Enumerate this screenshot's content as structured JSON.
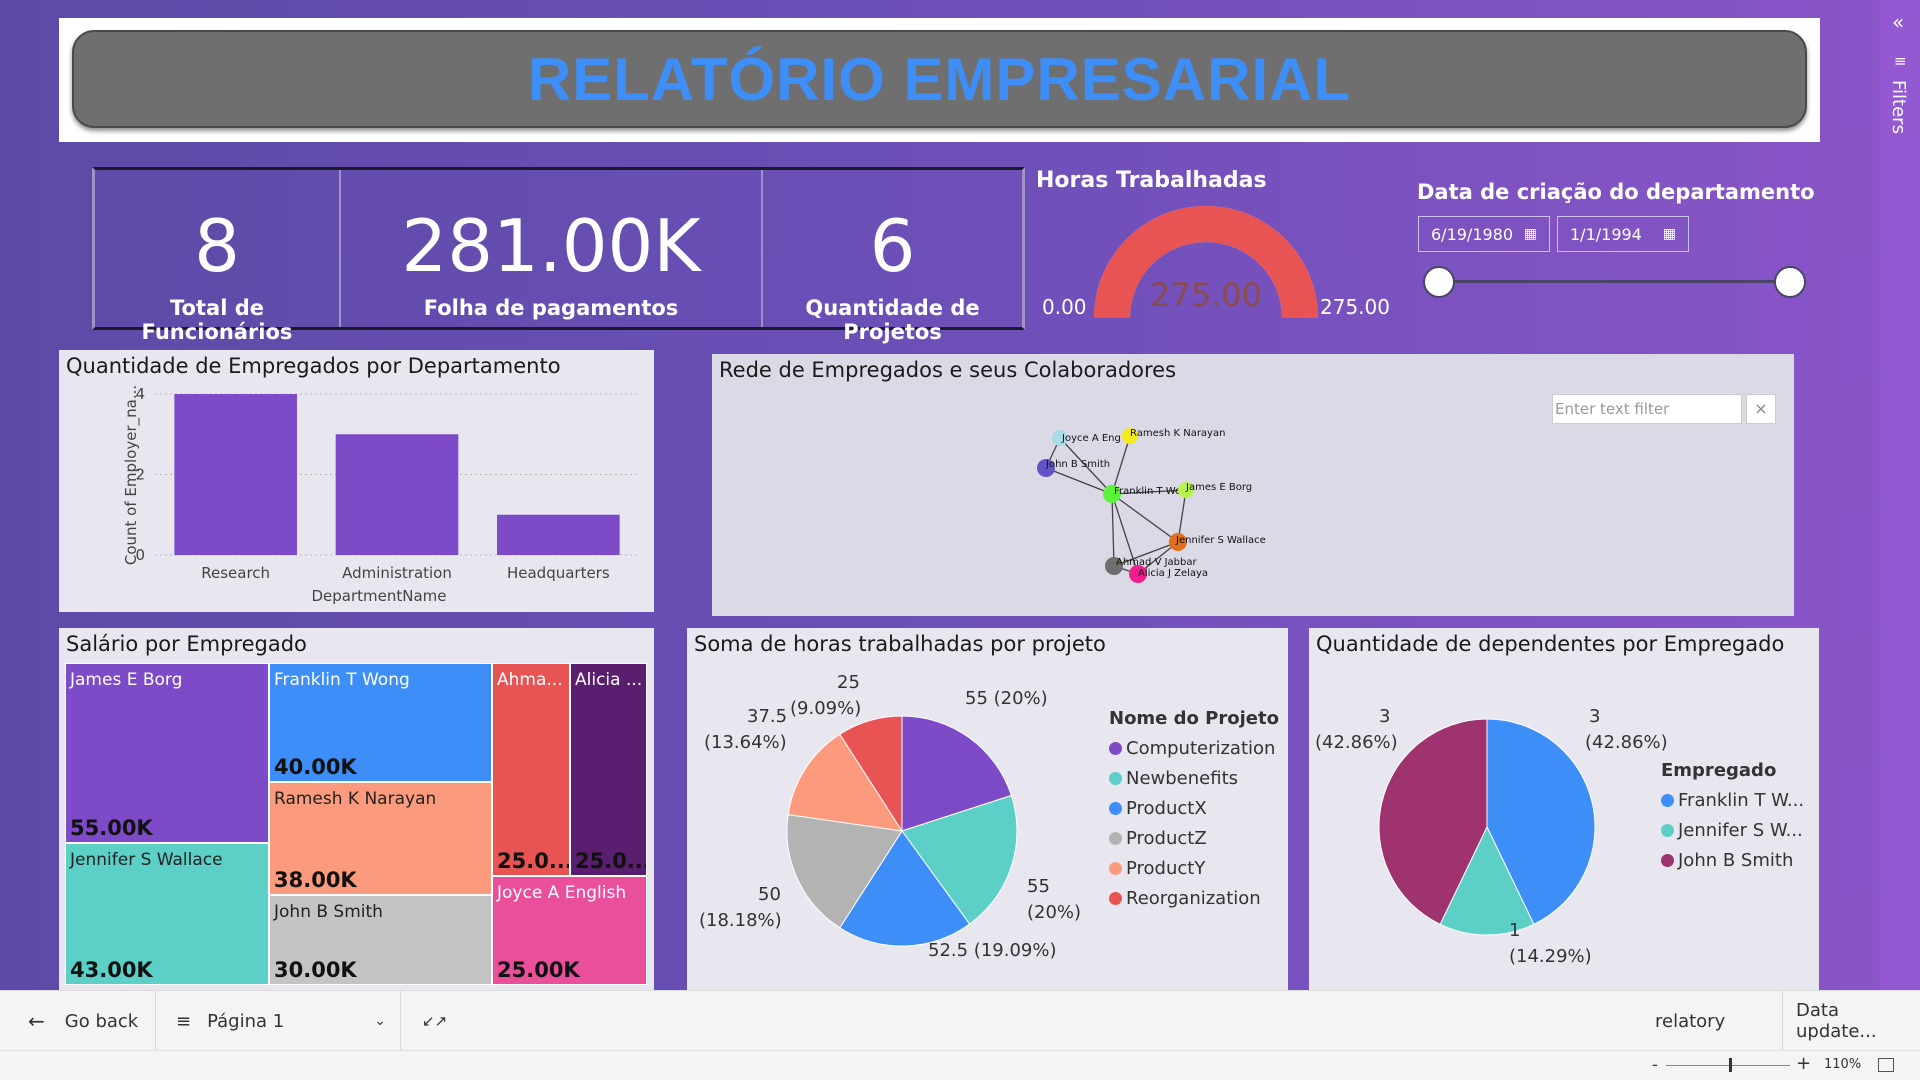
{
  "header": {
    "title": "RELATÓRIO EMPRESARIAL"
  },
  "kpis": [
    {
      "value": "8",
      "label": "Total de Funcionários"
    },
    {
      "value": "281.00K",
      "label": "Folha de pagamentos"
    },
    {
      "value": "6",
      "label": "Quantidade de Projetos"
    }
  ],
  "gauge": {
    "title": "Horas Trabalhadas",
    "min": "0.00",
    "max": "275.00",
    "value": "275.00",
    "fill_fraction": 1.0,
    "color": "#e85454"
  },
  "slicer": {
    "title": "Data de criação do departamento",
    "start": "6/19/1980",
    "end": "1/1/1994",
    "calendar_icon": "calendar-icon"
  },
  "bar_chart": {
    "title": "Quantidade de Empregados por Departamento",
    "ylabel": "Count of Employer_na...",
    "xlabel": "DepartmentName",
    "yticks": [
      "0",
      "2",
      "4"
    ]
  },
  "network": {
    "title": "Rede de Empregados e seus Colaboradores",
    "filter_placeholder": "Enter text filter",
    "clear_label": "×",
    "nodes": [
      {
        "label": "Joyce A Eng",
        "color": "#a7dbe8"
      },
      {
        "label": "Ramesh K Narayan",
        "color": "#f5ea1c"
      },
      {
        "label": "John B Smith",
        "color": "#6353c9"
      },
      {
        "label": "Franklin T Wo",
        "color": "#5cf23a"
      },
      {
        "label": "James E Borg",
        "color": "#b8f24a"
      },
      {
        "label": "Jennifer S Wallace",
        "color": "#e0701c"
      },
      {
        "label": "Ahmad V Jabbar",
        "color": "#6e6e6e"
      },
      {
        "label": "Alicia J Zelaya",
        "color": "#f01f8c"
      }
    ]
  },
  "treemap": {
    "title": "Salário por Empregado",
    "cells": [
      {
        "name": "James E Borg",
        "value": "55.00K",
        "color": "#7d4ac8"
      },
      {
        "name": "Franklin T Wong",
        "value": "40.00K",
        "color": "#3d8ef7"
      },
      {
        "name": "Ahma...",
        "value": "25.0...",
        "color": "#e85454"
      },
      {
        "name": "Alicia ...",
        "value": "25.0...",
        "color": "#5a1e6e"
      },
      {
        "name": "Ramesh K Narayan",
        "value": "38.00K",
        "color": "#fb9a7d"
      },
      {
        "name": "Jennifer S Wallace",
        "value": "43.00K",
        "color": "#5ccfc6"
      },
      {
        "name": "John B Smith",
        "value": "30.00K",
        "color": "#c4c4c4"
      },
      {
        "name": "Joyce A English",
        "value": "25.00K",
        "color": "#e94f9b"
      }
    ]
  },
  "project_pie": {
    "title": "Soma de horas trabalhadas por projeto",
    "legend_title": "Nome do Projeto",
    "labels": [
      {
        "line1": "55 (20%)",
        "line2": ""
      },
      {
        "line1": "55",
        "line2": "(20%)"
      },
      {
        "line1": "52.5 (19.09%)",
        "line2": ""
      },
      {
        "line1": "50",
        "line2": "(18.18%)"
      },
      {
        "line1": "37.5",
        "line2": "(13.64%)"
      },
      {
        "line1": "25",
        "line2": "(9.09%)"
      }
    ]
  },
  "dependents_pie": {
    "title": "Quantidade de dependentes por Empregado",
    "legend_title": "Empregado",
    "legend": [
      {
        "name": "Franklin T W...",
        "color": "#3d8ef7"
      },
      {
        "name": "Jennifer S W...",
        "color": "#5ccfc6"
      },
      {
        "name": "John B Smith",
        "color": "#9e3370"
      }
    ],
    "labels": [
      {
        "line1": "3",
        "line2": "(42.86%)"
      },
      {
        "line1": "1",
        "line2": "(14.29%)"
      },
      {
        "line1": "3",
        "line2": "(42.86%)"
      }
    ]
  },
  "chart_data": [
    {
      "type": "bar",
      "title": "Quantidade de Empregados por Departamento",
      "categories": [
        "Research",
        "Administration",
        "Headquarters"
      ],
      "values": [
        4,
        3,
        1
      ],
      "xlabel": "DepartmentName",
      "ylabel": "Count of Employer_na...",
      "ylim": [
        0,
        4
      ],
      "color": "#7d4ac8"
    },
    {
      "type": "pie",
      "title": "Soma de horas trabalhadas por projeto",
      "categories": [
        "Computerization",
        "Newbenefits",
        "ProductX",
        "ProductZ",
        "ProductY",
        "Reorganization"
      ],
      "values": [
        55,
        55,
        52.5,
        50,
        37.5,
        25
      ],
      "colors": [
        "#7d4ac8",
        "#5ccfc6",
        "#3d8ef7",
        "#b3b3b3",
        "#fb9a7d",
        "#e85454"
      ]
    },
    {
      "type": "pie",
      "title": "Quantidade de dependentes por Empregado",
      "categories": [
        "Franklin T W...",
        "Jennifer S W...",
        "John B Smith"
      ],
      "values": [
        3,
        1,
        3
      ],
      "colors": [
        "#3d8ef7",
        "#5ccfc6",
        "#9e3370"
      ]
    }
  ],
  "filters_pane": {
    "label": "Filters",
    "collapse_icon": "chevron-left-icon"
  },
  "bottom_bar": {
    "go_back": "Go back",
    "page": "Página 1",
    "report_name": "relatory",
    "data_updated": "Data update...",
    "zoom": "110%",
    "zoom_minus": "-",
    "zoom_plus": "+"
  }
}
